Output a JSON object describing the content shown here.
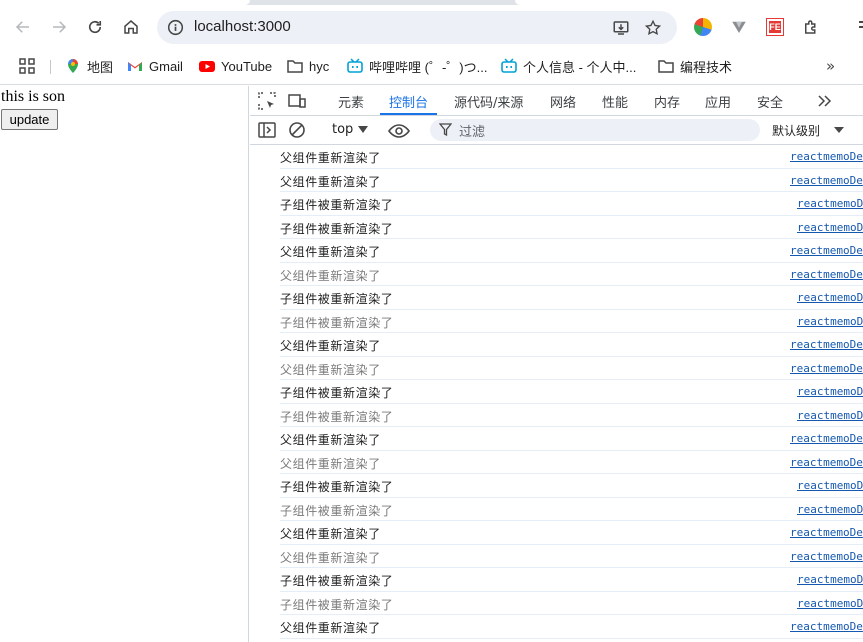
{
  "browser": {
    "url": "localhost:3000",
    "bookmarks": [
      {
        "label": "地图",
        "icon": "maps-icon"
      },
      {
        "label": "Gmail",
        "icon": "gmail-icon"
      },
      {
        "label": "YouTube",
        "icon": "youtube-icon"
      },
      {
        "label": "hyc",
        "icon": "folder-icon"
      },
      {
        "label": "哔哩哔哩 (゜-゜)つ...",
        "icon": "bilibili-icon"
      },
      {
        "label": "个人信息 - 个人中...",
        "icon": "bilibili-icon"
      },
      {
        "label": "编程技术",
        "icon": "folder-icon"
      }
    ],
    "extension_fe_label": "FE"
  },
  "page": {
    "text": "this is son",
    "button_label": "update"
  },
  "devtools": {
    "tabs": [
      "元素",
      "控制台",
      "源代码/来源",
      "网络",
      "性能",
      "内存",
      "应用",
      "安全"
    ],
    "active_tab": "控制台",
    "context": "top",
    "filter_placeholder": "过滤",
    "levels_label": "默认级别"
  },
  "console": {
    "rows": [
      {
        "text": "父组件重新渲染了",
        "source": "reactmemoDe",
        "dim": false
      },
      {
        "text": "父组件重新渲染了",
        "source": "reactmemoDe",
        "dim": false
      },
      {
        "text": "子组件被重新渲染了",
        "source": "reactmemoD",
        "dim": false
      },
      {
        "text": "子组件被重新渲染了",
        "source": "reactmemoD",
        "dim": false
      },
      {
        "text": "父组件重新渲染了",
        "source": "reactmemoDe",
        "dim": false
      },
      {
        "text": "父组件重新渲染了",
        "source": "reactmemoDe",
        "dim": true
      },
      {
        "text": "子组件被重新渲染了",
        "source": "reactmemoD",
        "dim": false
      },
      {
        "text": "子组件被重新渲染了",
        "source": "reactmemoD",
        "dim": true
      },
      {
        "text": "父组件重新渲染了",
        "source": "reactmemoDe",
        "dim": false
      },
      {
        "text": "父组件重新渲染了",
        "source": "reactmemoDe",
        "dim": true
      },
      {
        "text": "子组件被重新渲染了",
        "source": "reactmemoD",
        "dim": false
      },
      {
        "text": "子组件被重新渲染了",
        "source": "reactmemoD",
        "dim": true
      },
      {
        "text": "父组件重新渲染了",
        "source": "reactmemoDe",
        "dim": false
      },
      {
        "text": "父组件重新渲染了",
        "source": "reactmemoDe",
        "dim": true
      },
      {
        "text": "子组件被重新渲染了",
        "source": "reactmemoD",
        "dim": false
      },
      {
        "text": "子组件被重新渲染了",
        "source": "reactmemoD",
        "dim": true
      },
      {
        "text": "父组件重新渲染了",
        "source": "reactmemoDe",
        "dim": false
      },
      {
        "text": "父组件重新渲染了",
        "source": "reactmemoDe",
        "dim": true
      },
      {
        "text": "子组件被重新渲染了",
        "source": "reactmemoD",
        "dim": false
      },
      {
        "text": "子组件被重新渲染了",
        "source": "reactmemoD",
        "dim": true
      },
      {
        "text": "父组件重新渲染了",
        "source": "reactmemoDe",
        "dim": false
      }
    ]
  },
  "colors": {
    "accent": "#1a73e8",
    "link": "#1558b0",
    "dim_text": "#7a7a7a"
  }
}
